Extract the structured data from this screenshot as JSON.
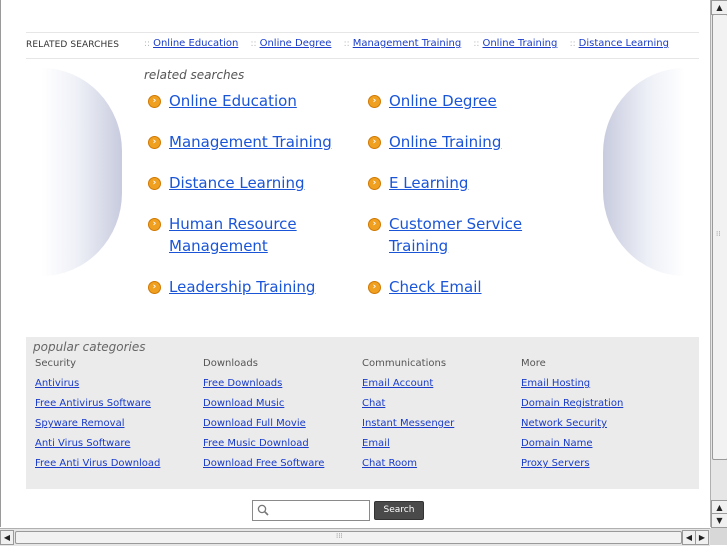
{
  "related_bar": {
    "label": "RELATED SEARCHES",
    "separator": "::",
    "links": [
      "Online Education",
      "Online Degree",
      "Management Training",
      "Online Training",
      "Distance Learning"
    ]
  },
  "related": {
    "title": "related searches",
    "left": [
      "Online Education",
      "Management Training",
      "Distance Learning",
      "Human Resource Management",
      "Leadership Training"
    ],
    "right": [
      "Online Degree",
      "Online Training",
      "E Learning",
      "Customer Service Training",
      "Check Email"
    ]
  },
  "popular": {
    "title": "popular categories",
    "columns": [
      {
        "head": "Security",
        "links": [
          "Antivirus",
          "Free Antivirus Software",
          "Spyware Removal",
          "Anti Virus Software",
          "Free Anti Virus Download"
        ]
      },
      {
        "head": "Downloads",
        "links": [
          "Free Downloads",
          "Download Music",
          "Download Full Movie",
          "Free Music Download",
          "Download Free Software"
        ]
      },
      {
        "head": "Communications",
        "links": [
          "Email Account",
          "Chat",
          "Instant Messenger",
          "Email",
          "Chat Room"
        ]
      },
      {
        "head": "More",
        "links": [
          "Email Hosting",
          "Domain Registration",
          "Network Security",
          "Domain Name",
          "Proxy Servers"
        ]
      }
    ]
  },
  "search": {
    "button": "Search",
    "value": ""
  },
  "colors": {
    "link": "#1a55d8",
    "arrow": "#f0a020",
    "panel": "#ebebeb"
  }
}
